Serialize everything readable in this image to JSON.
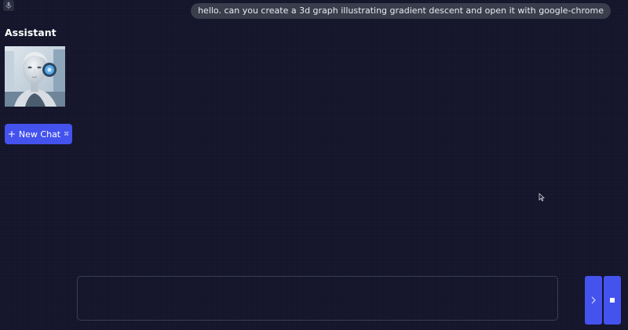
{
  "header": {
    "mic_icon": "microphone-icon"
  },
  "messages": [
    {
      "role": "user",
      "text": "hello. can you create a 3d graph illustrating gradient descent and open it with google-chrome"
    }
  ],
  "assistant": {
    "title": "Assistant",
    "avatar_icon": "robot-avatar"
  },
  "sidebar": {
    "new_chat": {
      "plus": "+",
      "label": "New Chat",
      "shortcut_icon": "command-key-icon"
    }
  },
  "input": {
    "value": "",
    "placeholder": ""
  },
  "controls": {
    "send_icon": "chevron-right-icon",
    "stop_icon": "stop-square-icon"
  },
  "colors": {
    "background": "#13142a",
    "accent": "#4452ee",
    "bubble": "#3a3d4c",
    "input_border": "#3b3d52"
  }
}
